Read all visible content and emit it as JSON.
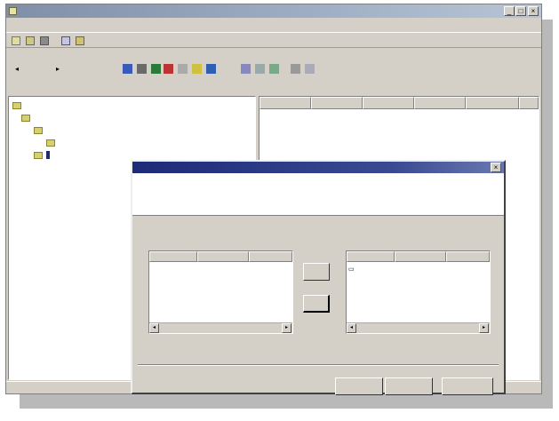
{
  "app": {
    "title": "",
    "menu": [
      "",
      "",
      ""
    ],
    "toolbar2": {
      "back_label": "",
      "forward_label": ""
    },
    "tree": {
      "items": [
        "",
        "",
        "",
        "",
        ""
      ]
    },
    "list_columns": [
      "",
      "",
      "",
      "",
      ""
    ],
    "status": ""
  },
  "dialog": {
    "title": "",
    "heading": "",
    "available_label": "",
    "selected_label": "",
    "available_columns": [
      "",
      "",
      ""
    ],
    "selected_columns": [
      "",
      "",
      ""
    ],
    "selected_rows": [
      {
        "name": "",
        "device": "",
        "size": ""
      }
    ],
    "total_label": "",
    "total_value": "",
    "total_unit": "",
    "add_button": "",
    "remove_button": "",
    "back_button": "",
    "next_button": "",
    "cancel_button": ""
  },
  "colors": {
    "dialog_title_start": "#1d2a77",
    "face": "#d4d0c8",
    "selection": "#1c2d6a"
  }
}
